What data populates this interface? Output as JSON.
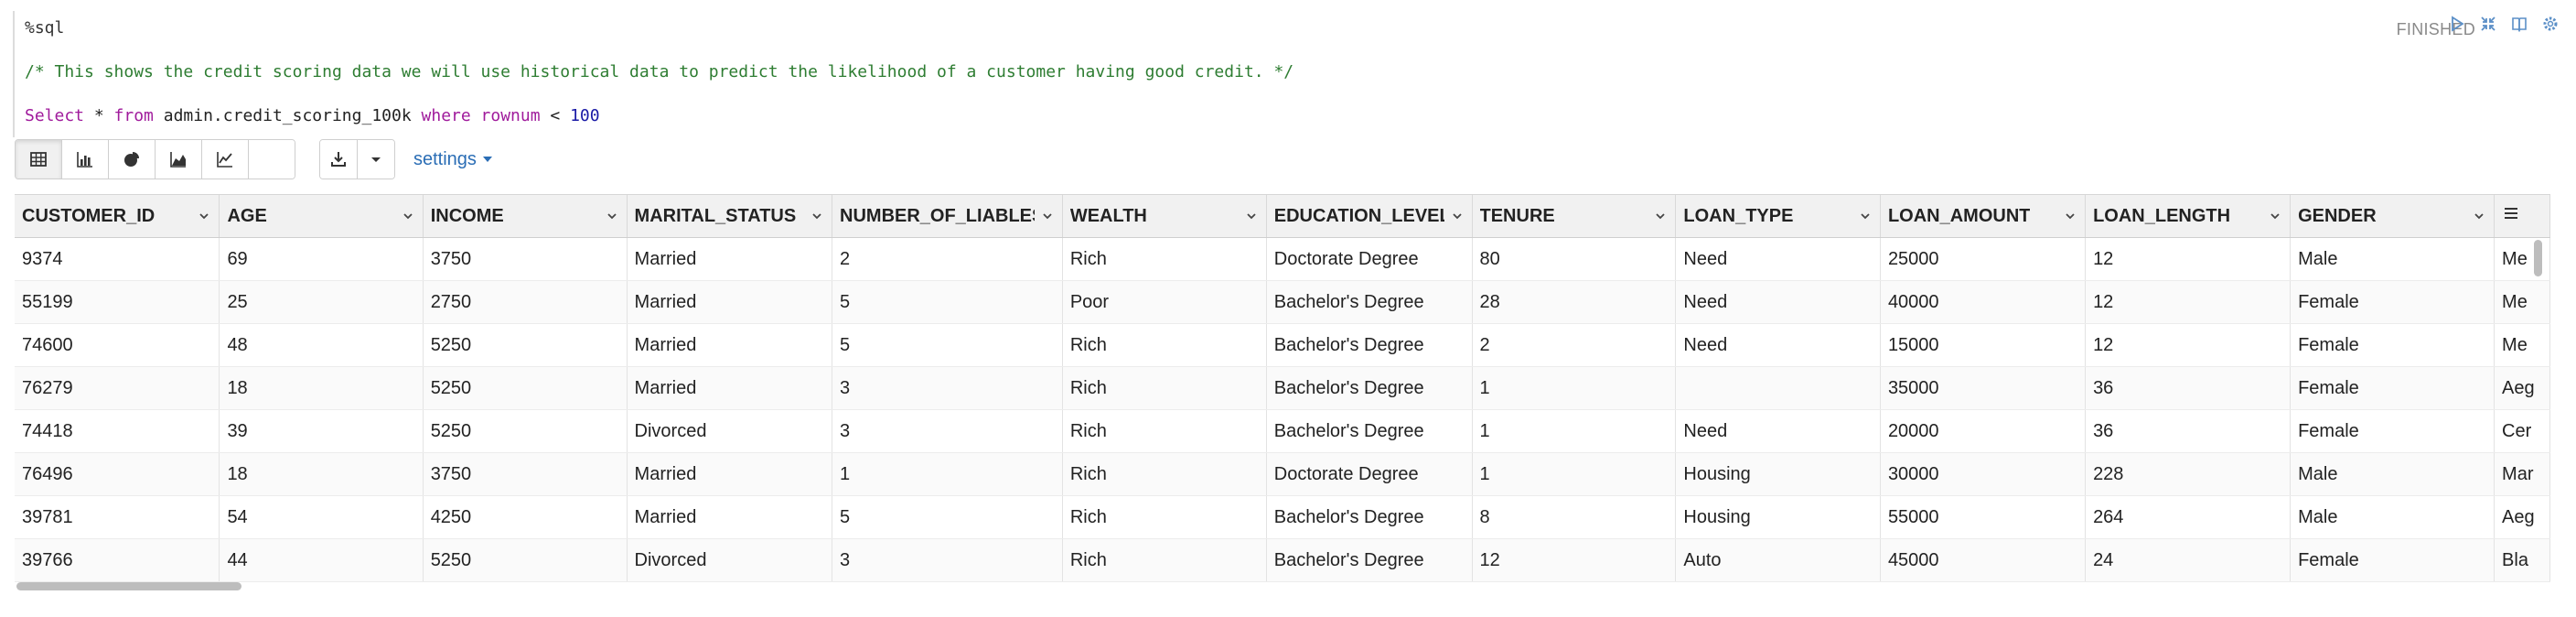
{
  "paragraph": {
    "magic": "%sql",
    "comment": "/* This shows the credit scoring data we will use historical data to predict the likelihood of a customer having good credit. */",
    "query": {
      "select_kw": "Select",
      "star": " * ",
      "from_kw": "from",
      "table": " admin.credit_scoring_100k ",
      "where_kw": "where",
      "rownum_kw": " rownum",
      "op": " < ",
      "limit": "100"
    },
    "status": "FINISHED"
  },
  "toolbar": {
    "buttons": [
      "table-icon",
      "bar-chart-icon",
      "pie-chart-icon",
      "area-chart-icon",
      "line-chart-icon",
      "blank"
    ],
    "settings_label": "settings"
  },
  "table": {
    "columns": [
      "CUSTOMER_ID",
      "AGE",
      "INCOME",
      "MARITAL_STATUS",
      "NUMBER_OF_LIABLES",
      "WEALTH",
      "EDUCATION_LEVEL",
      "TENURE",
      "LOAN_TYPE",
      "LOAN_AMOUNT",
      "LOAN_LENGTH",
      "GENDER"
    ],
    "rows": [
      [
        "9374",
        "69",
        "3750",
        "Married",
        "2",
        "Rich",
        "Doctorate Degree",
        "80",
        "Need",
        "25000",
        "12",
        "Male",
        "Me"
      ],
      [
        "55199",
        "25",
        "2750",
        "Married",
        "5",
        "Poor",
        "Bachelor's Degree",
        "28",
        "Need",
        "40000",
        "12",
        "Female",
        "Me"
      ],
      [
        "74600",
        "48",
        "5250",
        "Married",
        "5",
        "Rich",
        "Bachelor's Degree",
        "2",
        "Need",
        "15000",
        "12",
        "Female",
        "Me"
      ],
      [
        "76279",
        "18",
        "5250",
        "Married",
        "3",
        "Rich",
        "Bachelor's Degree",
        "1",
        "",
        "35000",
        "36",
        "Female",
        "Aeg"
      ],
      [
        "74418",
        "39",
        "5250",
        "Divorced",
        "3",
        "Rich",
        "Bachelor's Degree",
        "1",
        "Need",
        "20000",
        "36",
        "Female",
        "Cer"
      ],
      [
        "76496",
        "18",
        "3750",
        "Married",
        "1",
        "Rich",
        "Doctorate Degree",
        "1",
        "Housing",
        "30000",
        "228",
        "Male",
        "Mar"
      ],
      [
        "39781",
        "54",
        "4250",
        "Married",
        "5",
        "Rich",
        "Bachelor's Degree",
        "8",
        "Housing",
        "55000",
        "264",
        "Male",
        "Aeg"
      ],
      [
        "39766",
        "44",
        "5250",
        "Divorced",
        "3",
        "Rich",
        "Bachelor's Degree",
        "12",
        "Auto",
        "45000",
        "24",
        "Female",
        "Bla"
      ]
    ]
  },
  "colors": {
    "comment": "#2e7d32",
    "keyword": "#a01b9c",
    "number": "#1a1aa6",
    "link": "#2a6db5",
    "header_bg": "#f1f1f1"
  }
}
